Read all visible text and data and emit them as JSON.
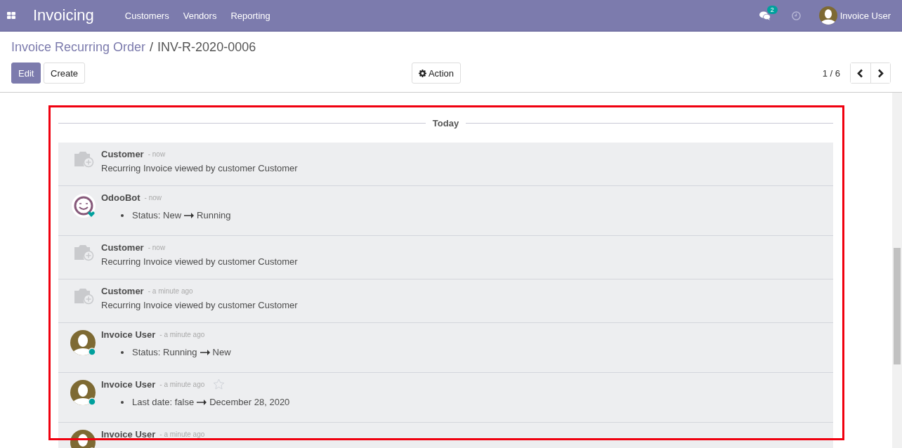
{
  "navbar": {
    "app_title": "Invoicing",
    "menu": [
      {
        "label": "Customers"
      },
      {
        "label": "Vendors"
      },
      {
        "label": "Reporting"
      }
    ],
    "messages_badge": "2",
    "user": "Invoice User"
  },
  "breadcrumb": {
    "parent": "Invoice Recurring Order",
    "separator": "/",
    "current": "INV-R-2020-0006"
  },
  "buttons": {
    "edit": "Edit",
    "create": "Create",
    "action": "Action"
  },
  "pager": {
    "value": "1 / 6"
  },
  "thread": {
    "date_separator": "Today",
    "messages": [
      {
        "author": "Customer",
        "date": "- now",
        "kind": "camera",
        "hovered": false,
        "body": "Recurring Invoice viewed by customer Customer"
      },
      {
        "author": "OdooBot",
        "date": "- now",
        "kind": "bot",
        "hovered": false,
        "tracking": [
          {
            "label": "Status:",
            "old": "New",
            "new": "Running"
          }
        ]
      },
      {
        "author": "Customer",
        "date": "- now",
        "kind": "camera",
        "hovered": false,
        "body": "Recurring Invoice viewed by customer Customer"
      },
      {
        "author": "Customer",
        "date": "- a minute ago",
        "kind": "camera",
        "hovered": false,
        "body": "Recurring Invoice viewed by customer Customer"
      },
      {
        "author": "Invoice User",
        "date": "- a minute ago",
        "kind": "user",
        "hovered": false,
        "tracking": [
          {
            "label": "Status:",
            "old": "Running",
            "new": "New"
          }
        ]
      },
      {
        "author": "Invoice User",
        "date": "- a minute ago",
        "kind": "user",
        "hovered": true,
        "tracking": [
          {
            "label": "Last date:",
            "old": "false",
            "new": "December 28, 2020"
          }
        ]
      },
      {
        "author": "Invoice User",
        "date": "- a minute ago",
        "kind": "user",
        "hovered": false
      }
    ]
  }
}
